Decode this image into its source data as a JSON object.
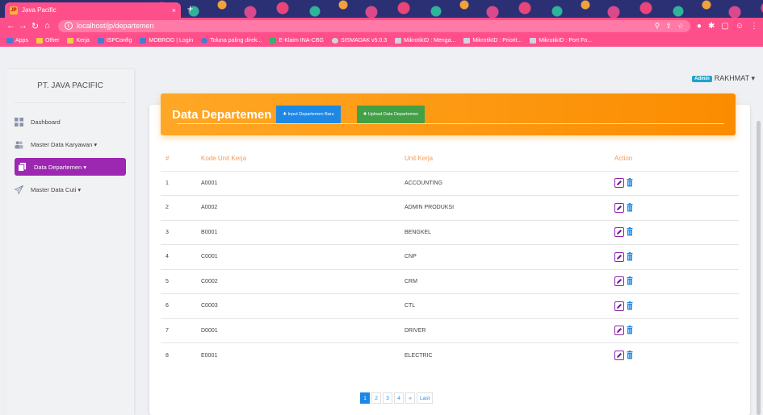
{
  "browser": {
    "tab_title": "Java Pacific",
    "tab_close": "×",
    "new_tab": "+",
    "url": "localhost/jp/departemen",
    "bookmarks": [
      {
        "label": "Apps",
        "icon": "apps-grid-icon"
      },
      {
        "label": "Other",
        "icon": "folder-icon"
      },
      {
        "label": "Kerja",
        "icon": "folder-icon"
      },
      {
        "label": "ISPConfig",
        "icon": "ispconfig-icon"
      },
      {
        "label": "MOBROG | Login",
        "icon": "mobrog-icon"
      },
      {
        "label": "Toluna paling direk...",
        "icon": "toluna-icon"
      },
      {
        "label": "E-Klaim INA-CBG",
        "icon": "eklaim-icon"
      },
      {
        "label": "SISMADAK v5.0.3",
        "icon": "sismadak-icon"
      },
      {
        "label": "MikrotikID : Menga...",
        "icon": "mikrotik-icon"
      },
      {
        "label": "MikrotikID : Priorit...",
        "icon": "mikrotik-icon"
      },
      {
        "label": "MikrotikID : Port Fo...",
        "icon": "mikrotik-icon"
      }
    ]
  },
  "sidebar": {
    "brand": "PT. JAVA PACIFIC",
    "items": [
      {
        "label": "Dashboard",
        "icon": "dashboard-icon",
        "active": false
      },
      {
        "label": "Master Data Karyawan ▾",
        "icon": "users-icon",
        "active": false
      },
      {
        "label": "Data Departemen ▾",
        "icon": "documents-icon",
        "active": true
      },
      {
        "label": "Master Data Cuti ▾",
        "icon": "paper-plane-icon",
        "active": false
      }
    ]
  },
  "user": {
    "role": "Admin",
    "name": "RAKHMAT ▾"
  },
  "card": {
    "title": "Data Departemen",
    "btn_input": "✚ Input Departemen Baru",
    "btn_upload": "✚ Upload Data Departemen"
  },
  "table": {
    "headers": [
      "#",
      "Kode Unit Kerja",
      "Unit Kerja",
      "Action"
    ],
    "rows": [
      {
        "no": "1",
        "kode": "A0001",
        "unit": "ACCOUNTING"
      },
      {
        "no": "2",
        "kode": "A0002",
        "unit": "ADMIN PRODUKSI"
      },
      {
        "no": "3",
        "kode": "B0001",
        "unit": "BENGKEL"
      },
      {
        "no": "4",
        "kode": "C0001",
        "unit": "CNP"
      },
      {
        "no": "5",
        "kode": "C0002",
        "unit": "CRM"
      },
      {
        "no": "6",
        "kode": "C0003",
        "unit": "CTL"
      },
      {
        "no": "7",
        "kode": "D0001",
        "unit": "DRIVER"
      },
      {
        "no": "8",
        "kode": "E0001",
        "unit": "ELECTRIC"
      }
    ]
  },
  "pagination": [
    "1",
    "2",
    "3",
    "4",
    "»",
    "Last"
  ],
  "colors": {
    "accent": "#ff4f8a",
    "active_menu": "#9c27b0",
    "header": "#fb8c00",
    "primary": "#1e88e5",
    "success": "#43a047"
  }
}
